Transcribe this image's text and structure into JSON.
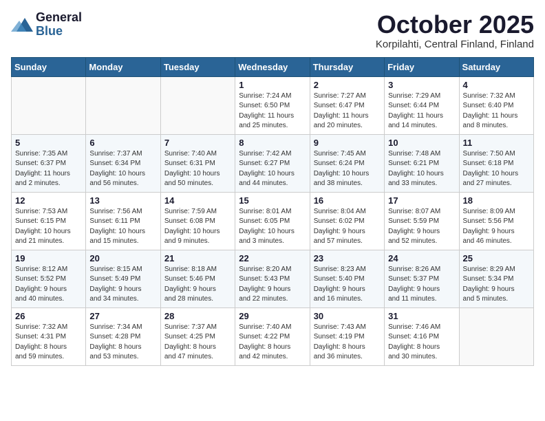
{
  "header": {
    "logo_general": "General",
    "logo_blue": "Blue",
    "title": "October 2025",
    "subtitle": "Korpilahti, Central Finland, Finland"
  },
  "weekdays": [
    "Sunday",
    "Monday",
    "Tuesday",
    "Wednesday",
    "Thursday",
    "Friday",
    "Saturday"
  ],
  "weeks": [
    [
      {
        "day": "",
        "info": ""
      },
      {
        "day": "",
        "info": ""
      },
      {
        "day": "",
        "info": ""
      },
      {
        "day": "1",
        "info": "Sunrise: 7:24 AM\nSunset: 6:50 PM\nDaylight: 11 hours\nand 25 minutes."
      },
      {
        "day": "2",
        "info": "Sunrise: 7:27 AM\nSunset: 6:47 PM\nDaylight: 11 hours\nand 20 minutes."
      },
      {
        "day": "3",
        "info": "Sunrise: 7:29 AM\nSunset: 6:44 PM\nDaylight: 11 hours\nand 14 minutes."
      },
      {
        "day": "4",
        "info": "Sunrise: 7:32 AM\nSunset: 6:40 PM\nDaylight: 11 hours\nand 8 minutes."
      }
    ],
    [
      {
        "day": "5",
        "info": "Sunrise: 7:35 AM\nSunset: 6:37 PM\nDaylight: 11 hours\nand 2 minutes."
      },
      {
        "day": "6",
        "info": "Sunrise: 7:37 AM\nSunset: 6:34 PM\nDaylight: 10 hours\nand 56 minutes."
      },
      {
        "day": "7",
        "info": "Sunrise: 7:40 AM\nSunset: 6:31 PM\nDaylight: 10 hours\nand 50 minutes."
      },
      {
        "day": "8",
        "info": "Sunrise: 7:42 AM\nSunset: 6:27 PM\nDaylight: 10 hours\nand 44 minutes."
      },
      {
        "day": "9",
        "info": "Sunrise: 7:45 AM\nSunset: 6:24 PM\nDaylight: 10 hours\nand 38 minutes."
      },
      {
        "day": "10",
        "info": "Sunrise: 7:48 AM\nSunset: 6:21 PM\nDaylight: 10 hours\nand 33 minutes."
      },
      {
        "day": "11",
        "info": "Sunrise: 7:50 AM\nSunset: 6:18 PM\nDaylight: 10 hours\nand 27 minutes."
      }
    ],
    [
      {
        "day": "12",
        "info": "Sunrise: 7:53 AM\nSunset: 6:15 PM\nDaylight: 10 hours\nand 21 minutes."
      },
      {
        "day": "13",
        "info": "Sunrise: 7:56 AM\nSunset: 6:11 PM\nDaylight: 10 hours\nand 15 minutes."
      },
      {
        "day": "14",
        "info": "Sunrise: 7:59 AM\nSunset: 6:08 PM\nDaylight: 10 hours\nand 9 minutes."
      },
      {
        "day": "15",
        "info": "Sunrise: 8:01 AM\nSunset: 6:05 PM\nDaylight: 10 hours\nand 3 minutes."
      },
      {
        "day": "16",
        "info": "Sunrise: 8:04 AM\nSunset: 6:02 PM\nDaylight: 9 hours\nand 57 minutes."
      },
      {
        "day": "17",
        "info": "Sunrise: 8:07 AM\nSunset: 5:59 PM\nDaylight: 9 hours\nand 52 minutes."
      },
      {
        "day": "18",
        "info": "Sunrise: 8:09 AM\nSunset: 5:56 PM\nDaylight: 9 hours\nand 46 minutes."
      }
    ],
    [
      {
        "day": "19",
        "info": "Sunrise: 8:12 AM\nSunset: 5:52 PM\nDaylight: 9 hours\nand 40 minutes."
      },
      {
        "day": "20",
        "info": "Sunrise: 8:15 AM\nSunset: 5:49 PM\nDaylight: 9 hours\nand 34 minutes."
      },
      {
        "day": "21",
        "info": "Sunrise: 8:18 AM\nSunset: 5:46 PM\nDaylight: 9 hours\nand 28 minutes."
      },
      {
        "day": "22",
        "info": "Sunrise: 8:20 AM\nSunset: 5:43 PM\nDaylight: 9 hours\nand 22 minutes."
      },
      {
        "day": "23",
        "info": "Sunrise: 8:23 AM\nSunset: 5:40 PM\nDaylight: 9 hours\nand 16 minutes."
      },
      {
        "day": "24",
        "info": "Sunrise: 8:26 AM\nSunset: 5:37 PM\nDaylight: 9 hours\nand 11 minutes."
      },
      {
        "day": "25",
        "info": "Sunrise: 8:29 AM\nSunset: 5:34 PM\nDaylight: 9 hours\nand 5 minutes."
      }
    ],
    [
      {
        "day": "26",
        "info": "Sunrise: 7:32 AM\nSunset: 4:31 PM\nDaylight: 8 hours\nand 59 minutes."
      },
      {
        "day": "27",
        "info": "Sunrise: 7:34 AM\nSunset: 4:28 PM\nDaylight: 8 hours\nand 53 minutes."
      },
      {
        "day": "28",
        "info": "Sunrise: 7:37 AM\nSunset: 4:25 PM\nDaylight: 8 hours\nand 47 minutes."
      },
      {
        "day": "29",
        "info": "Sunrise: 7:40 AM\nSunset: 4:22 PM\nDaylight: 8 hours\nand 42 minutes."
      },
      {
        "day": "30",
        "info": "Sunrise: 7:43 AM\nSunset: 4:19 PM\nDaylight: 8 hours\nand 36 minutes."
      },
      {
        "day": "31",
        "info": "Sunrise: 7:46 AM\nSunset: 4:16 PM\nDaylight: 8 hours\nand 30 minutes."
      },
      {
        "day": "",
        "info": ""
      }
    ]
  ]
}
